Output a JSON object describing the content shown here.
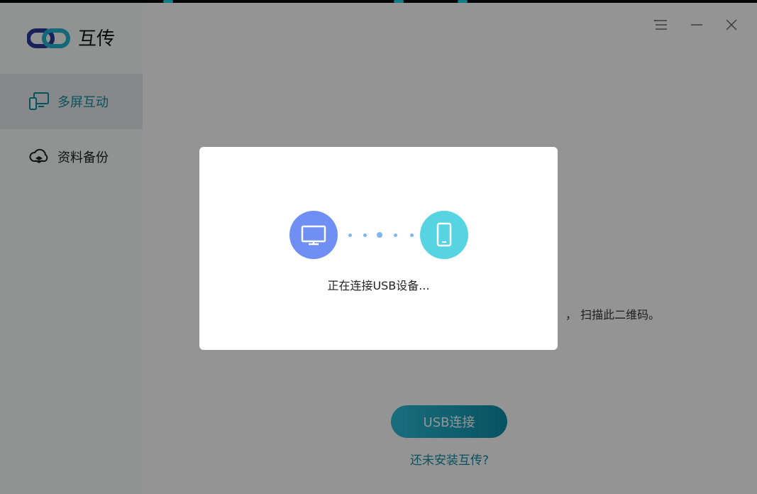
{
  "app": {
    "title": "互传",
    "colors": {
      "accent": "#0f8da4",
      "pc_circle": "#6f8ff4",
      "phone_circle": "#56d4e2"
    }
  },
  "sidebar": {
    "items": [
      {
        "label": "多屏互动",
        "icon": "multi-screen-icon",
        "active": true
      },
      {
        "label": "资料备份",
        "icon": "cloud-backup-icon",
        "active": false
      }
    ]
  },
  "window_controls": {
    "menu": "menu-icon",
    "minimize": "minimize-icon",
    "close": "close-icon"
  },
  "main": {
    "hint_text": "， 扫描此二维码。",
    "usb_button": "USB连接",
    "install_link": "还未安装互传?"
  },
  "modal": {
    "message": "正在连接USB设备...",
    "left_icon": "monitor-icon",
    "right_icon": "phone-icon"
  }
}
